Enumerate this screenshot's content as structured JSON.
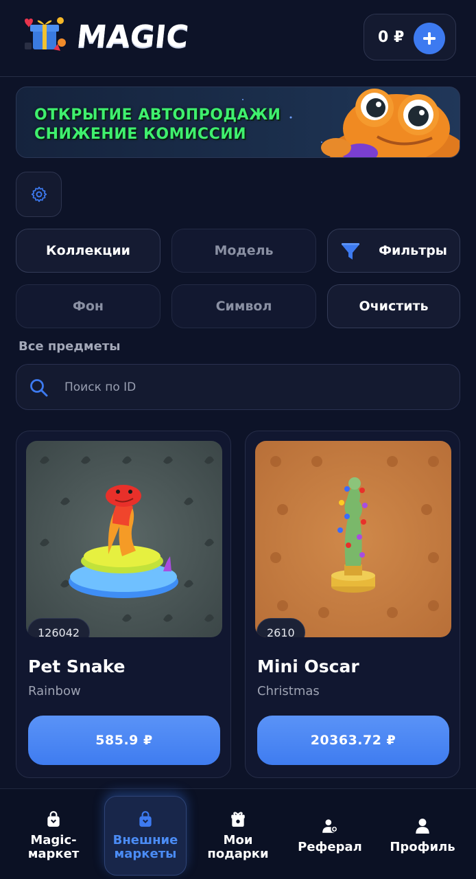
{
  "header": {
    "logo_text": "MAGIC",
    "balance": "0 ₽",
    "add_funds_icon": "plus-icon"
  },
  "banner": {
    "line1": "ОТКРЫТИЕ АВТОПРОДАЖИ",
    "line2": "СНИЖЕНИЕ КОМИССИИ"
  },
  "filters": {
    "collections": "Коллекции",
    "model": "Модель",
    "filters": "Фильтры",
    "background": "Фон",
    "symbol": "Символ",
    "clear": "Очистить"
  },
  "section_label": "Все предметы",
  "search": {
    "placeholder": "Поиск по ID",
    "value": ""
  },
  "items": [
    {
      "id": "126042",
      "name": "Pet Snake",
      "subtitle": "Rainbow",
      "price": "585.9 ₽"
    },
    {
      "id": "2610",
      "name": "Mini Oscar",
      "subtitle": "Christmas",
      "price": "20363.72 ₽"
    }
  ],
  "bottom_nav": [
    {
      "label": "Magic-\nмаркет",
      "icon": "shopping-bag-icon",
      "active": false
    },
    {
      "label": "Внешние\nмаркеты",
      "icon": "shopping-bag-icon",
      "active": true
    },
    {
      "label": "Мои\nподарки",
      "icon": "gift-icon",
      "active": false
    },
    {
      "label": "Реферал",
      "icon": "users-icon",
      "active": false
    },
    {
      "label": "Профиль",
      "icon": "user-icon",
      "active": false
    }
  ],
  "colors": {
    "background": "#0d1328",
    "accent": "#3d7af0",
    "banner_text": "#3ff06e"
  }
}
